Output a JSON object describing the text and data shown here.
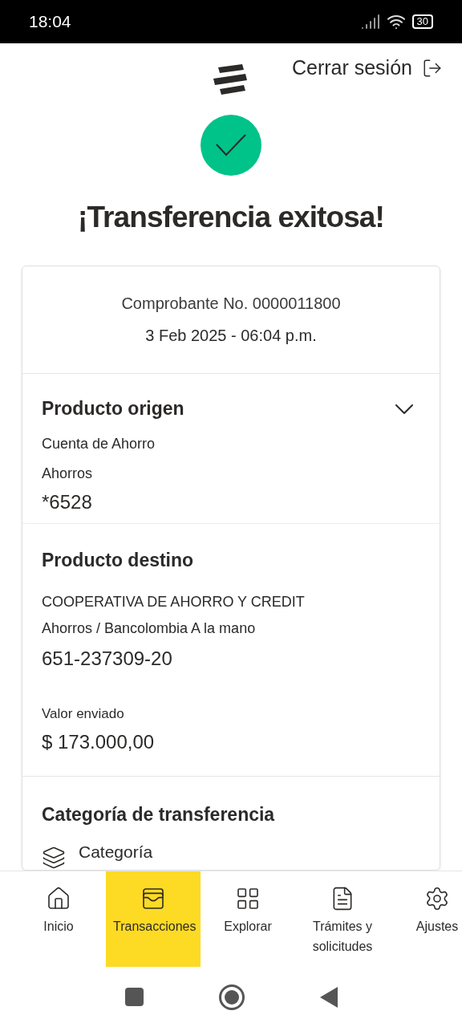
{
  "status_bar": {
    "time": "18:04",
    "battery": "30"
  },
  "header": {
    "logout": "Cerrar sesión"
  },
  "title": "¡Transferencia exitosa!",
  "receipt": {
    "number": "Comprobante No. 0000011800",
    "date": "3 Feb 2025 - 06:04 p.m."
  },
  "origin": {
    "title": "Producto origen",
    "type": "Cuenta de Ahorro",
    "subtype": "Ahorros",
    "account": "*6528"
  },
  "destination": {
    "title": "Producto destino",
    "name": "COOPERATIVA DE AHORRO Y CREDIT",
    "detail": "Ahorros / Bancolombia A la mano",
    "account": "651-237309-20",
    "amount_label": "Valor enviado",
    "amount": "$ 173.000,00"
  },
  "category": {
    "title": "Categoría de transferencia",
    "label": "Categoría"
  },
  "nav": [
    {
      "label": "Inicio",
      "selected": false
    },
    {
      "label": "Transacciones",
      "selected": true
    },
    {
      "label": "Explorar",
      "selected": false
    },
    {
      "label": "Trámites y solicitudes",
      "selected": false
    },
    {
      "label": "Ajustes",
      "selected": false
    }
  ]
}
